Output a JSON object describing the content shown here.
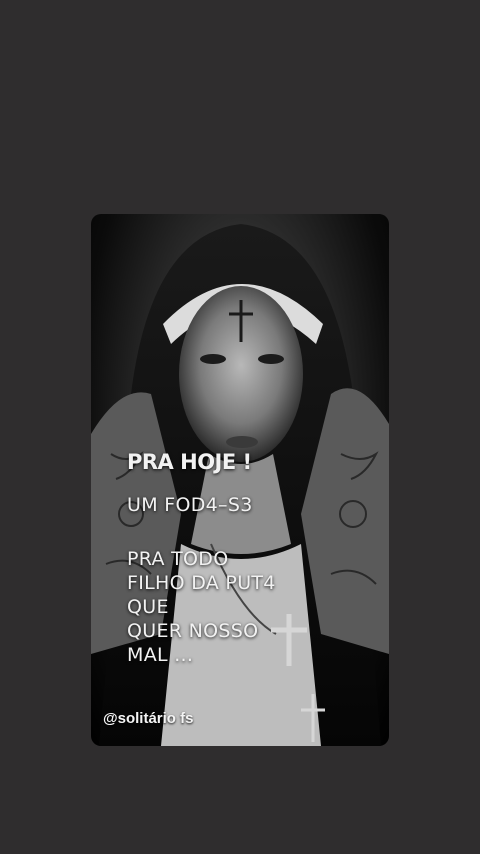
{
  "post": {
    "headline": "PRA HOJE !",
    "line1": "UM FOD4–S3",
    "lines": [
      "PRA TODO",
      "FILHO DA PUT4",
      "QUE",
      "QUER NOSSO",
      "MAL ..."
    ],
    "author_handle": "@solitário fs"
  },
  "colors": {
    "background": "#2f2d2e",
    "text": "#f2f2f2"
  },
  "icons": {
    "forehead_mark": "cross-icon",
    "necklace": "crucifix-icon"
  }
}
